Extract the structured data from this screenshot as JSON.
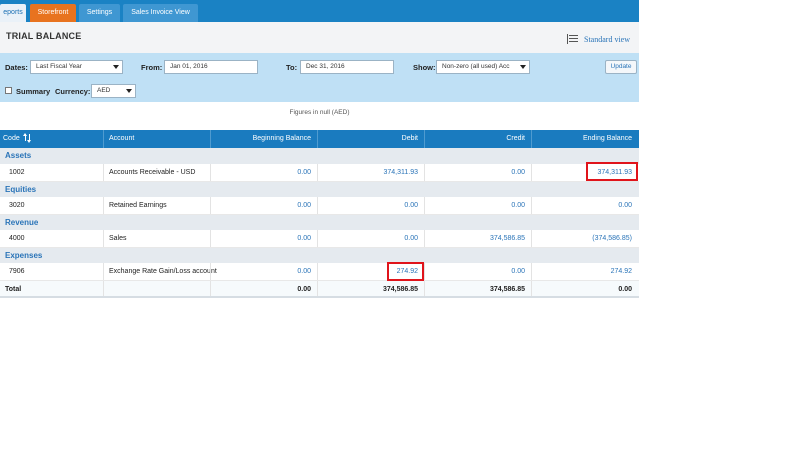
{
  "tabs": [
    {
      "label": "eports",
      "style": "active"
    },
    {
      "label": "Storefront",
      "style": "orange"
    },
    {
      "label": "Settings",
      "style": "normal"
    },
    {
      "label": "Sales Invoice View",
      "style": "normal"
    }
  ],
  "header": {
    "title": "TRIAL BALANCE",
    "standard_view": "Standard view"
  },
  "filters": {
    "dates_label": "Dates:",
    "dates_value": "Last Fiscal Year",
    "from_label": "From:",
    "from_value": "Jan 01, 2016",
    "to_label": "To:",
    "to_value": "Dec 31, 2016",
    "show_label": "Show:",
    "show_value": "Non-zero (all used) Acc",
    "summary_label": "Summary",
    "currency_label": "Currency:",
    "currency_value": "AED",
    "update_label": "Update"
  },
  "figures_note": "Figures in null (AED)",
  "table": {
    "columns": [
      "Code",
      "Account",
      "Beginning Balance",
      "Debit",
      "Credit",
      "Ending Balance"
    ],
    "groups": [
      {
        "name": "Assets",
        "rows": [
          {
            "code": "1002",
            "account": "Accounts Receivable - USD",
            "beginning": "0.00",
            "debit": "374,311.93",
            "credit": "0.00",
            "ending": "374,311.93"
          }
        ]
      },
      {
        "name": "Equities",
        "rows": [
          {
            "code": "3020",
            "account": "Retained Earnings",
            "beginning": "0.00",
            "debit": "0.00",
            "credit": "0.00",
            "ending": "0.00"
          }
        ]
      },
      {
        "name": "Revenue",
        "rows": [
          {
            "code": "4000",
            "account": "Sales",
            "beginning": "0.00",
            "debit": "0.00",
            "credit": "374,586.85",
            "ending": "(374,586.85)"
          }
        ]
      },
      {
        "name": "Expenses",
        "rows": [
          {
            "code": "7906",
            "account": "Exchange Rate Gain/Loss account",
            "beginning": "0.00",
            "debit": "274.92",
            "credit": "0.00",
            "ending": "274.92"
          }
        ]
      }
    ],
    "total": {
      "label": "Total",
      "beginning": "0.00",
      "debit": "374,586.85",
      "credit": "374,586.85",
      "ending": "0.00"
    }
  },
  "colors": {
    "tabbar": "#1a82c4",
    "accent_orange": "#e8731f",
    "table_header": "#1a7bbf",
    "highlight": "#e0141b"
  }
}
